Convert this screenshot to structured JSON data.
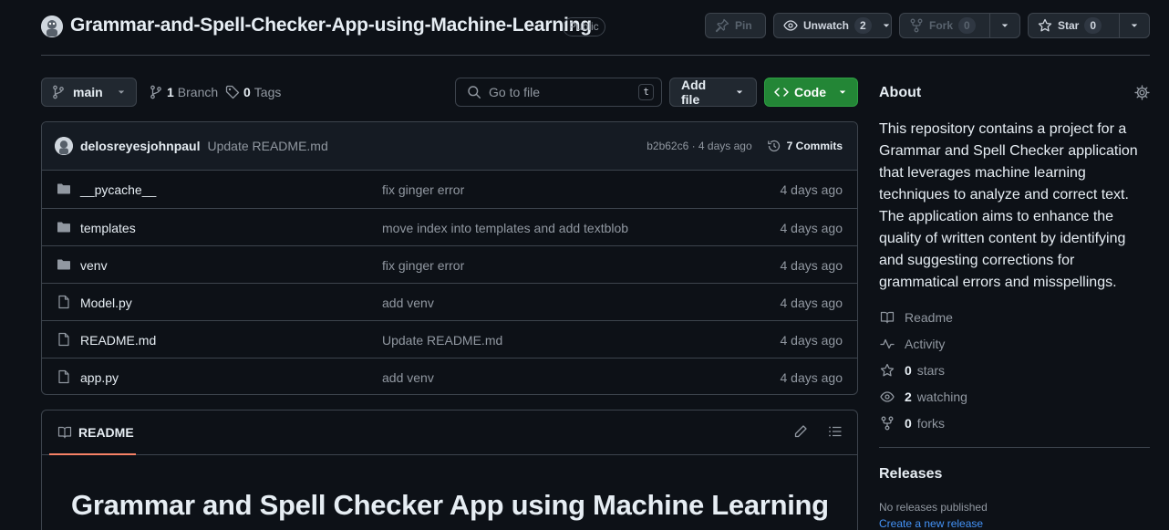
{
  "repo": {
    "name": "Grammar-and-Spell-Checker-App-using-Machine-Learning",
    "visibility": "Public"
  },
  "header_actions": {
    "pin_label": "Pin",
    "unwatch_label": "Unwatch",
    "watch_count": "2",
    "fork_label": "Fork",
    "fork_count": "0",
    "star_label": "Star",
    "star_count": "0"
  },
  "toolbar": {
    "branch": "main",
    "branch_count": "1",
    "branch_label": "Branch",
    "tag_count": "0",
    "tag_label": "Tags",
    "search_placeholder": "Go to file",
    "search_shortcut": "t",
    "add_file_label": "Add file",
    "code_label": "Code"
  },
  "latest_commit": {
    "author": "delosreyesjohnpaul",
    "message": "Update README.md",
    "sha_time": "b2b62c6 · 4 days ago",
    "commits_label": "7 Commits"
  },
  "files": [
    {
      "name": "__pycache__",
      "type": "dir",
      "message": "fix ginger error",
      "date": "4 days ago"
    },
    {
      "name": "templates",
      "type": "dir",
      "message": "move index into templates and add textblob",
      "date": "4 days ago"
    },
    {
      "name": "venv",
      "type": "dir",
      "message": "fix ginger error",
      "date": "4 days ago"
    },
    {
      "name": "Model.py",
      "type": "file",
      "message": "add venv",
      "date": "4 days ago"
    },
    {
      "name": "README.md",
      "type": "file",
      "message": "Update README.md",
      "date": "4 days ago"
    },
    {
      "name": "app.py",
      "type": "file",
      "message": "add venv",
      "date": "4 days ago"
    }
  ],
  "readme": {
    "tab_label": "README",
    "heading": "Grammar and Spell Checker App using Machine Learning"
  },
  "about": {
    "title": "About",
    "description": "This repository contains a project for a Grammar and Spell Checker application that leverages machine learning techniques to analyze and correct text. The application aims to enhance the quality of written content by identifying and suggesting corrections for grammatical errors and misspellings.",
    "readme_label": "Readme",
    "activity_label": "Activity",
    "stars_count": "0",
    "stars_label": "stars",
    "watching_count": "2",
    "watching_label": "watching",
    "forks_count": "0",
    "forks_label": "forks"
  },
  "releases": {
    "title": "Releases",
    "none_text": "No releases published",
    "create_link": "Create a new release"
  },
  "colors": {
    "background": "#0d1117",
    "border": "#3d444d",
    "code_button": "#238636",
    "link": "#4493f8",
    "tab_underline": "#f78166"
  }
}
